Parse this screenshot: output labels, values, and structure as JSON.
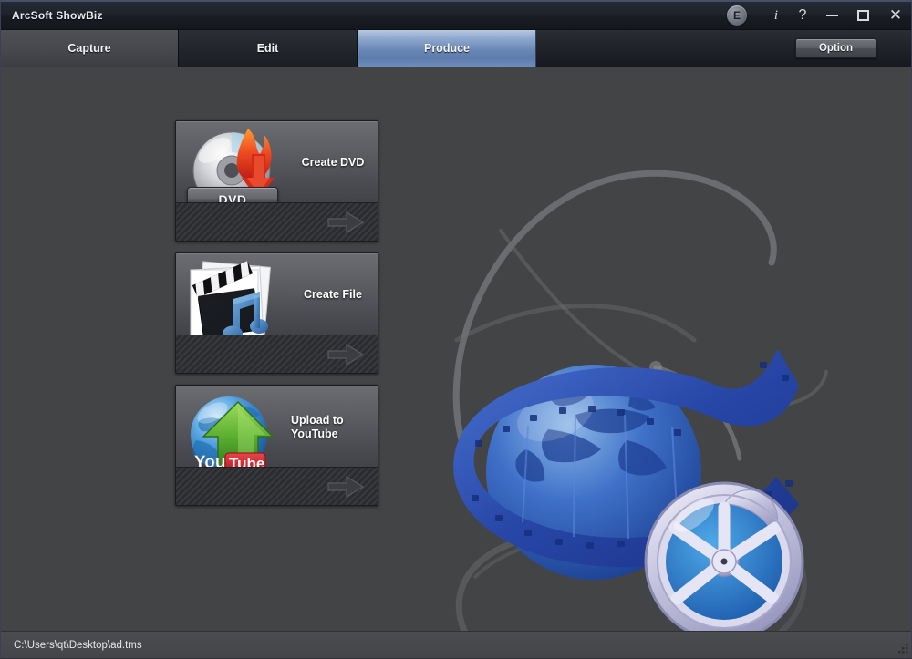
{
  "window": {
    "title": "ArcSoft ShowBiz",
    "controls": [
      {
        "name": "edition-badge",
        "label": "E"
      },
      {
        "name": "info-button",
        "label": "i"
      },
      {
        "name": "help-button",
        "label": "?"
      },
      {
        "name": "minimize-button",
        "label": ""
      },
      {
        "name": "maximize-button",
        "label": ""
      },
      {
        "name": "close-button",
        "label": "✕"
      }
    ]
  },
  "tabs": [
    {
      "label": "Capture",
      "active": false
    },
    {
      "label": "Edit",
      "active": false
    },
    {
      "label": "Produce",
      "active": true
    }
  ],
  "toolbar": {
    "option_label": "Option"
  },
  "produce": {
    "cards": [
      {
        "id": "create-dvd",
        "label": "Create DVD",
        "icon": "dvd-disc-burn-icon",
        "badge": "DVD"
      },
      {
        "id": "create-file",
        "label": "Create File",
        "icon": "clapperboard-music-icon",
        "badge": ""
      },
      {
        "id": "upload-youtube",
        "label": "Upload to YouTube",
        "icon": "youtube-globe-upload-icon",
        "badge": ""
      }
    ],
    "youtube_logo": {
      "you": "You",
      "tube": "Tube"
    }
  },
  "statusbar": {
    "path": "C:\\Users\\qt\\Desktop\\ad.tms"
  },
  "colors": {
    "window_bg": "#434446",
    "titlebar": "#191c23",
    "active_tab": "#6a88b6",
    "accent_blue": "#2b55b4",
    "youtube_red": "#cc2229",
    "upload_green": "#57a838"
  }
}
